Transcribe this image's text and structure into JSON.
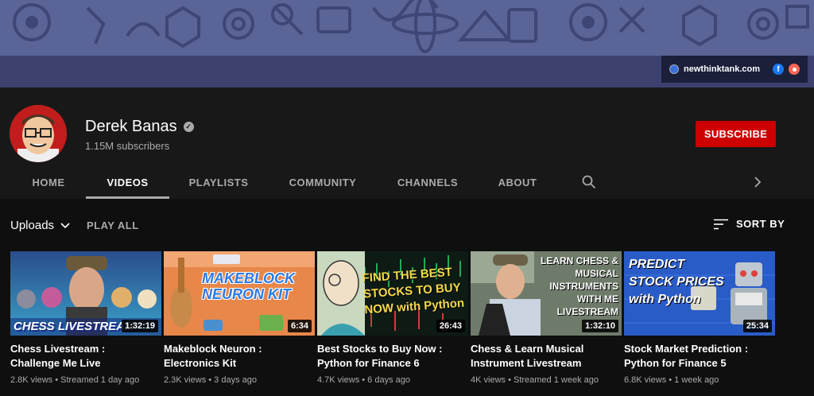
{
  "banner": {
    "link_text": "newthinktank.com",
    "facebook_glyph": "f",
    "colors": {
      "banner": "#5a6496",
      "strip": "#3d4170"
    }
  },
  "channel": {
    "name": "Derek Banas",
    "verified_glyph": "✓",
    "subscribers": "1.15M subscribers",
    "subscribe_label": "SUBSCRIBE",
    "subscribe_color": "#cc0000"
  },
  "tabs": [
    {
      "label": "HOME"
    },
    {
      "label": "VIDEOS",
      "active": true
    },
    {
      "label": "PLAYLISTS"
    },
    {
      "label": "COMMUNITY"
    },
    {
      "label": "CHANNELS"
    },
    {
      "label": "ABOUT"
    }
  ],
  "toolbar": {
    "uploads_label": "Uploads",
    "play_all_label": "PLAY ALL",
    "sort_label": "SORT BY"
  },
  "videos": [
    {
      "thumb_text": "CHESS LIVESTREAM",
      "duration": "1:32:19",
      "title": "Chess Livestream :\nChallenge Me Live",
      "meta": "2.8K views • Streamed 1 day ago"
    },
    {
      "thumb_text": "MAKEBLOCK NEURON KIT",
      "duration": "6:34",
      "title": "Makeblock Neuron :\nElectronics Kit",
      "meta": "2.3K views • 3 days ago"
    },
    {
      "thumb_text": "FIND THE BEST STOCKS TO BUY NOW with Python",
      "duration": "26:43",
      "title": "Best Stocks to Buy Now :\nPython for Finance 6",
      "meta": "4.7K views • 6 days ago"
    },
    {
      "thumb_text": "LEARN CHESS & MUSICAL INSTRUMENTS WITH ME LIVESTREAM",
      "duration": "1:32:10",
      "title": "Chess & Learn Musical\nInstrument Livestream",
      "meta": "4K views • Streamed 1 week ago"
    },
    {
      "thumb_text": "PREDICT STOCK PRICES with Python",
      "duration": "25:34",
      "title": "Stock Market Prediction :\nPython for Finance 5",
      "meta": "6.8K views • 1 week ago"
    }
  ]
}
